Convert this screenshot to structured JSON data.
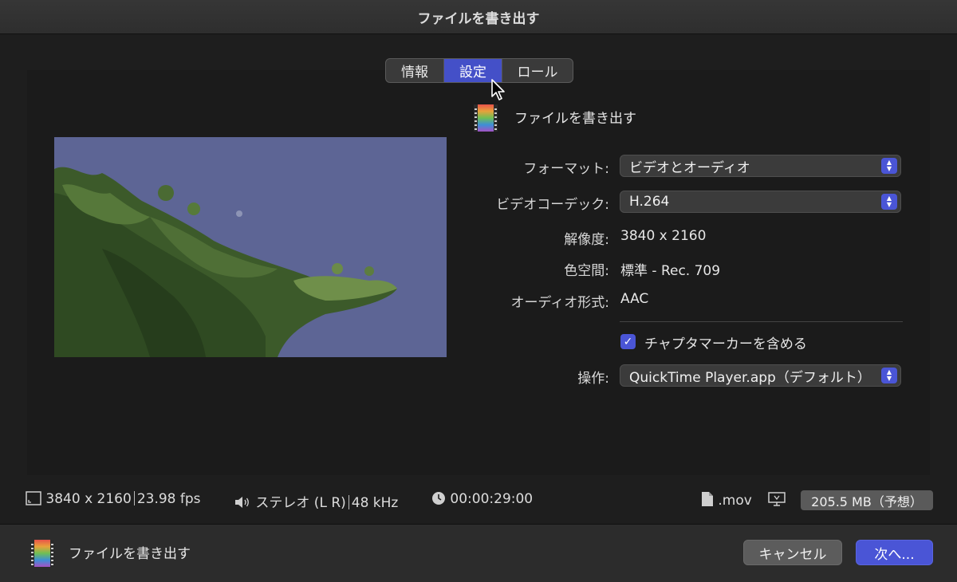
{
  "window": {
    "title": "ファイルを書き出す"
  },
  "tabs": [
    {
      "label": "情報",
      "selected": false
    },
    {
      "label": "設定",
      "selected": true
    },
    {
      "label": "ロール",
      "selected": false
    }
  ],
  "destination": {
    "label": "ファイルを書き出す",
    "icon": "film-strip-icon"
  },
  "settings": {
    "format": {
      "label": "フォーマット:",
      "value": "ビデオとオーディオ"
    },
    "video_codec": {
      "label": "ビデオコーデック:",
      "value": "H.264"
    },
    "resolution": {
      "label": "解像度:",
      "value": "3840 x 2160"
    },
    "color_space": {
      "label": "色空間:",
      "value": "標準 - Rec. 709"
    },
    "audio_format": {
      "label": "オーディオ形式:",
      "value": "AAC"
    },
    "chapter_markers": {
      "label": "チャプタマーカーを含める",
      "checked": true
    },
    "action": {
      "label": "操作:",
      "value": "QuickTime Player.app（デフォルト）"
    }
  },
  "infobar": {
    "resolution": "3840 x 2160",
    "fps": "23.98 fps",
    "audio": "ステレオ (L R)",
    "sample_rate": "48 kHz",
    "duration": "00:00:29:00",
    "extension": ".mov",
    "size": "205.5 MB（予想）"
  },
  "footer": {
    "label": "ファイルを書き出す",
    "cancel": "キャンセル",
    "next": "次へ..."
  },
  "colors": {
    "accent": "#4a55d6",
    "preview_sky": "#5d6595",
    "foliage": "#3c5a2a"
  }
}
